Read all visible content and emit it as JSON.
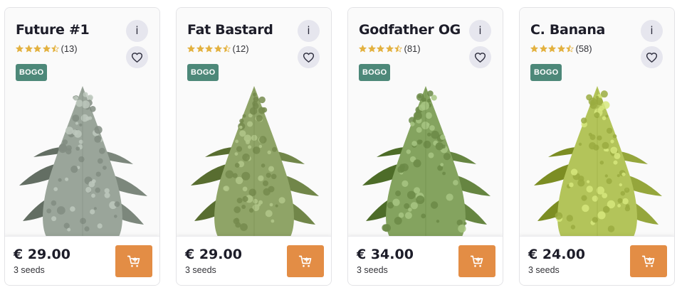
{
  "products": [
    {
      "name": "Future #1",
      "rating": 4.5,
      "reviews": "(13)",
      "badge": "BOGO",
      "price": "€ 29.00",
      "seeds": "3 seeds",
      "plant_color": "#9aa59a"
    },
    {
      "name": "Fat Bastard",
      "rating": 4.5,
      "reviews": "(12)",
      "badge": "BOGO",
      "price": "€ 29.00",
      "seeds": "3 seeds",
      "plant_color": "#8fa467"
    },
    {
      "name": "Godfather OG",
      "rating": 4.5,
      "reviews": "(81)",
      "badge": "BOGO",
      "price": "€ 34.00",
      "seeds": "3 seeds",
      "plant_color": "#84a35f"
    },
    {
      "name": "C. Banana",
      "rating": 4.5,
      "reviews": "(58)",
      "badge": "BOGO",
      "price": "€ 24.00",
      "seeds": "3 seeds",
      "plant_color": "#b3c45a"
    }
  ],
  "colors": {
    "accent": "#e38d45",
    "badge": "#4d8879",
    "star": "#e3b13f"
  },
  "icons": {
    "info": "i",
    "favorite": "heart-icon",
    "cart": "cart-plus-icon",
    "star": "star-icon"
  }
}
